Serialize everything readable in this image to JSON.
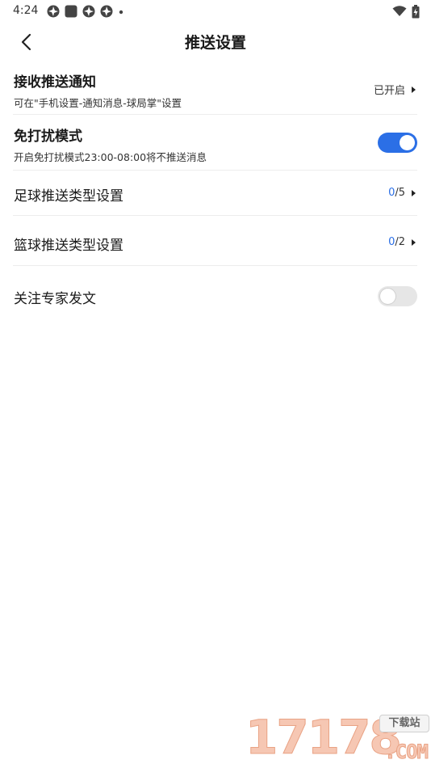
{
  "status_bar": {
    "time": "4:24",
    "icons_left": [
      "aperture-icon",
      "square-app-icon",
      "aperture-icon",
      "aperture-icon",
      "dot-icon"
    ],
    "icons_right": [
      "wifi-icon",
      "battery-icon"
    ]
  },
  "nav": {
    "title": "推送设置",
    "back_icon": "chevron-left-icon"
  },
  "settings": {
    "notify": {
      "title": "接收推送通知",
      "subtitle": "可在\"手机设置-通知消息-球局掌\"设置",
      "value": "已开启"
    },
    "dnd": {
      "title": "免打扰模式",
      "subtitle": "开启免打扰模式23:00-08:00将不推送消息",
      "enabled": true
    },
    "football": {
      "title": "足球推送类型设置",
      "selected": "0",
      "total": "/5"
    },
    "basketball": {
      "title": "篮球推送类型设置",
      "selected": "0",
      "total": "/2"
    },
    "expert": {
      "title": "关注专家发文",
      "enabled": false
    }
  },
  "watermark": {
    "digits": "17178",
    "badge": "下载站",
    "domain": ".COM"
  },
  "colors": {
    "accent": "#2b6fe6",
    "toggle_off": "#e6e6e6",
    "divider": "#ededed"
  }
}
